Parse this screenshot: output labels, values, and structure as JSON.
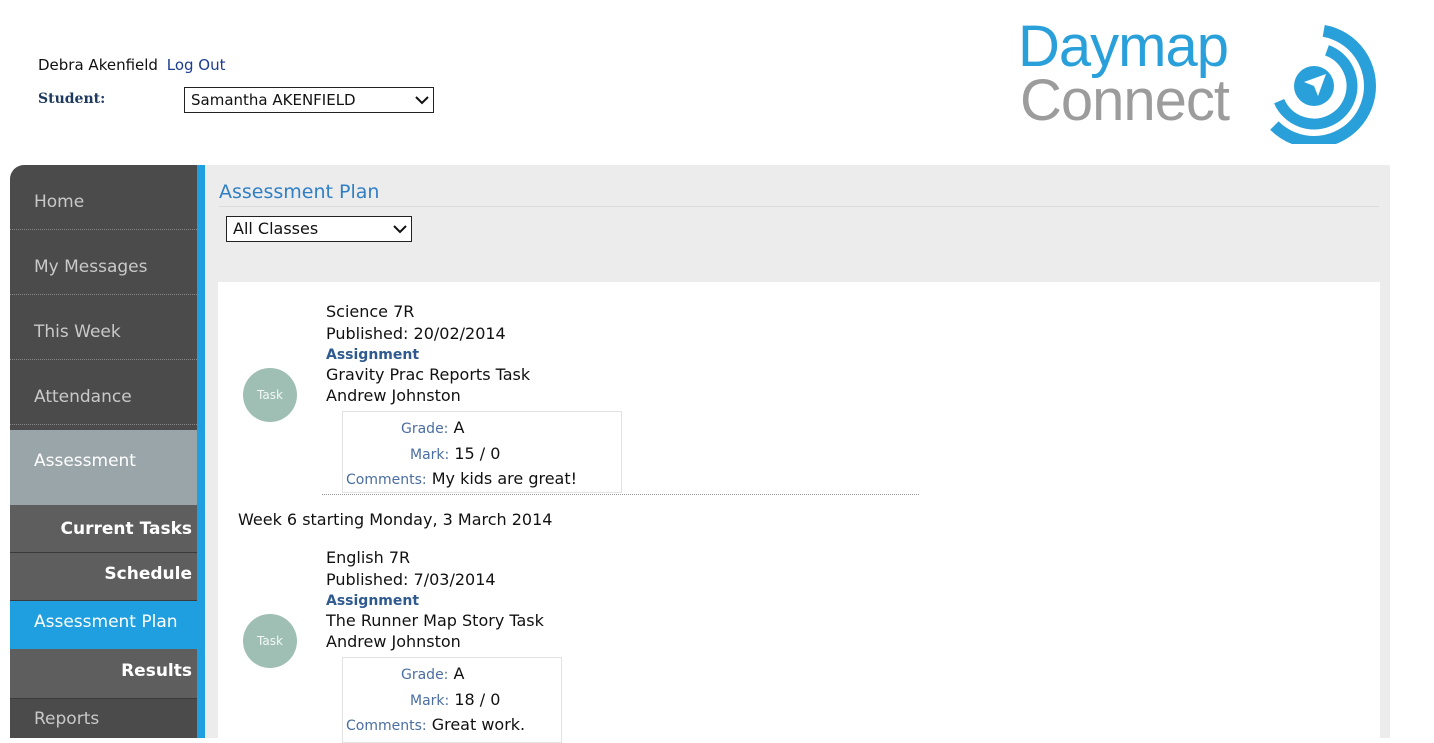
{
  "header": {
    "user_name": "Debra Akenfield",
    "logout_label": "Log Out",
    "student_label": "Student:",
    "student_selected": "Samantha AKENFIELD"
  },
  "logo": {
    "line1": "Daymap",
    "line2": "Connect",
    "color_primary": "#2aa0db",
    "color_secondary": "#9c9c9c"
  },
  "sidebar": {
    "items": [
      {
        "label": "Home"
      },
      {
        "label": "My Messages"
      },
      {
        "label": "This Week"
      },
      {
        "label": "Attendance"
      },
      {
        "label": "Assessment"
      },
      {
        "label": "Current Tasks"
      },
      {
        "label": "Schedule"
      },
      {
        "label": "Assessment Plan"
      },
      {
        "label": "Results"
      },
      {
        "label": "Reports"
      }
    ],
    "active": "Assessment Plan"
  },
  "main": {
    "title": "Assessment Plan",
    "class_filter": "All Classes",
    "tasks": [
      {
        "icon_label": "Task",
        "class_name": "Science 7R",
        "published": "Published: 20/02/2014",
        "type": "Assignment",
        "task_name": "Gravity Prac Reports Task",
        "teacher": "Andrew Johnston",
        "grade_label": "Grade:",
        "grade": "A",
        "mark_label": "Mark:",
        "mark": "15 / 0",
        "comments_label": "Comments:",
        "comments": "My kids are great!"
      },
      {
        "icon_label": "Task",
        "class_name": "English 7R",
        "published": "Published: 7/03/2014",
        "type": "Assignment",
        "task_name": "The Runner Map Story Task",
        "teacher": "Andrew Johnston",
        "grade_label": "Grade:",
        "grade": "A",
        "mark_label": "Mark:",
        "mark": "18 / 0",
        "comments_label": "Comments:",
        "comments": "Great work."
      }
    ],
    "week_header": "Week 6 starting Monday, 3 March 2014"
  },
  "colors": {
    "accent": "#1f9fdf",
    "sidebar": "#4b4b4b",
    "task_icon": "#9fbfb5"
  }
}
